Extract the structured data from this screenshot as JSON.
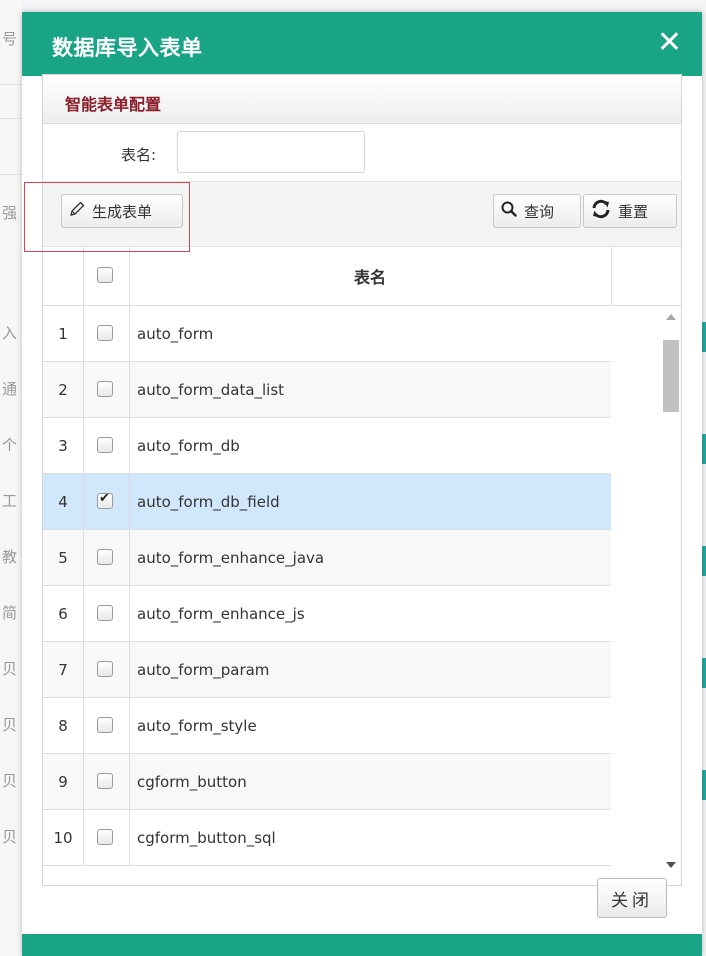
{
  "background": {
    "side_chars": [
      "号",
      "强",
      "入",
      "通",
      "个",
      "工",
      "教",
      "简",
      "贝",
      "贝",
      "贝",
      "贝"
    ]
  },
  "dialog": {
    "title": "数据库导入表单",
    "close_glyph": "✕",
    "panel_title": "智能表单配置",
    "search": {
      "label": "表名:",
      "value": "",
      "placeholder": ""
    },
    "toolbar": {
      "generate_label": "生成表单",
      "query_label": "查询",
      "reset_label": "重置"
    },
    "grid": {
      "header_name": "表名",
      "rows": [
        {
          "num": "1",
          "name": "auto_form",
          "checked": false
        },
        {
          "num": "2",
          "name": "auto_form_data_list",
          "checked": false
        },
        {
          "num": "3",
          "name": "auto_form_db",
          "checked": false
        },
        {
          "num": "4",
          "name": "auto_form_db_field",
          "checked": true
        },
        {
          "num": "5",
          "name": "auto_form_enhance_java",
          "checked": false
        },
        {
          "num": "6",
          "name": "auto_form_enhance_js",
          "checked": false
        },
        {
          "num": "7",
          "name": "auto_form_param",
          "checked": false
        },
        {
          "num": "8",
          "name": "auto_form_style",
          "checked": false
        },
        {
          "num": "9",
          "name": "cgform_button",
          "checked": false
        },
        {
          "num": "10",
          "name": "cgform_button_sql",
          "checked": false
        }
      ]
    },
    "close_button_label": "关闭"
  },
  "colors": {
    "titlebar": "#19a486",
    "panel_title": "#8a1f2b",
    "selected_row": "#d1e7fb",
    "highlight_box": "#e0454f"
  },
  "icons": {
    "generate": "pencil-icon",
    "query": "search-icon",
    "reset": "refresh-icon"
  }
}
